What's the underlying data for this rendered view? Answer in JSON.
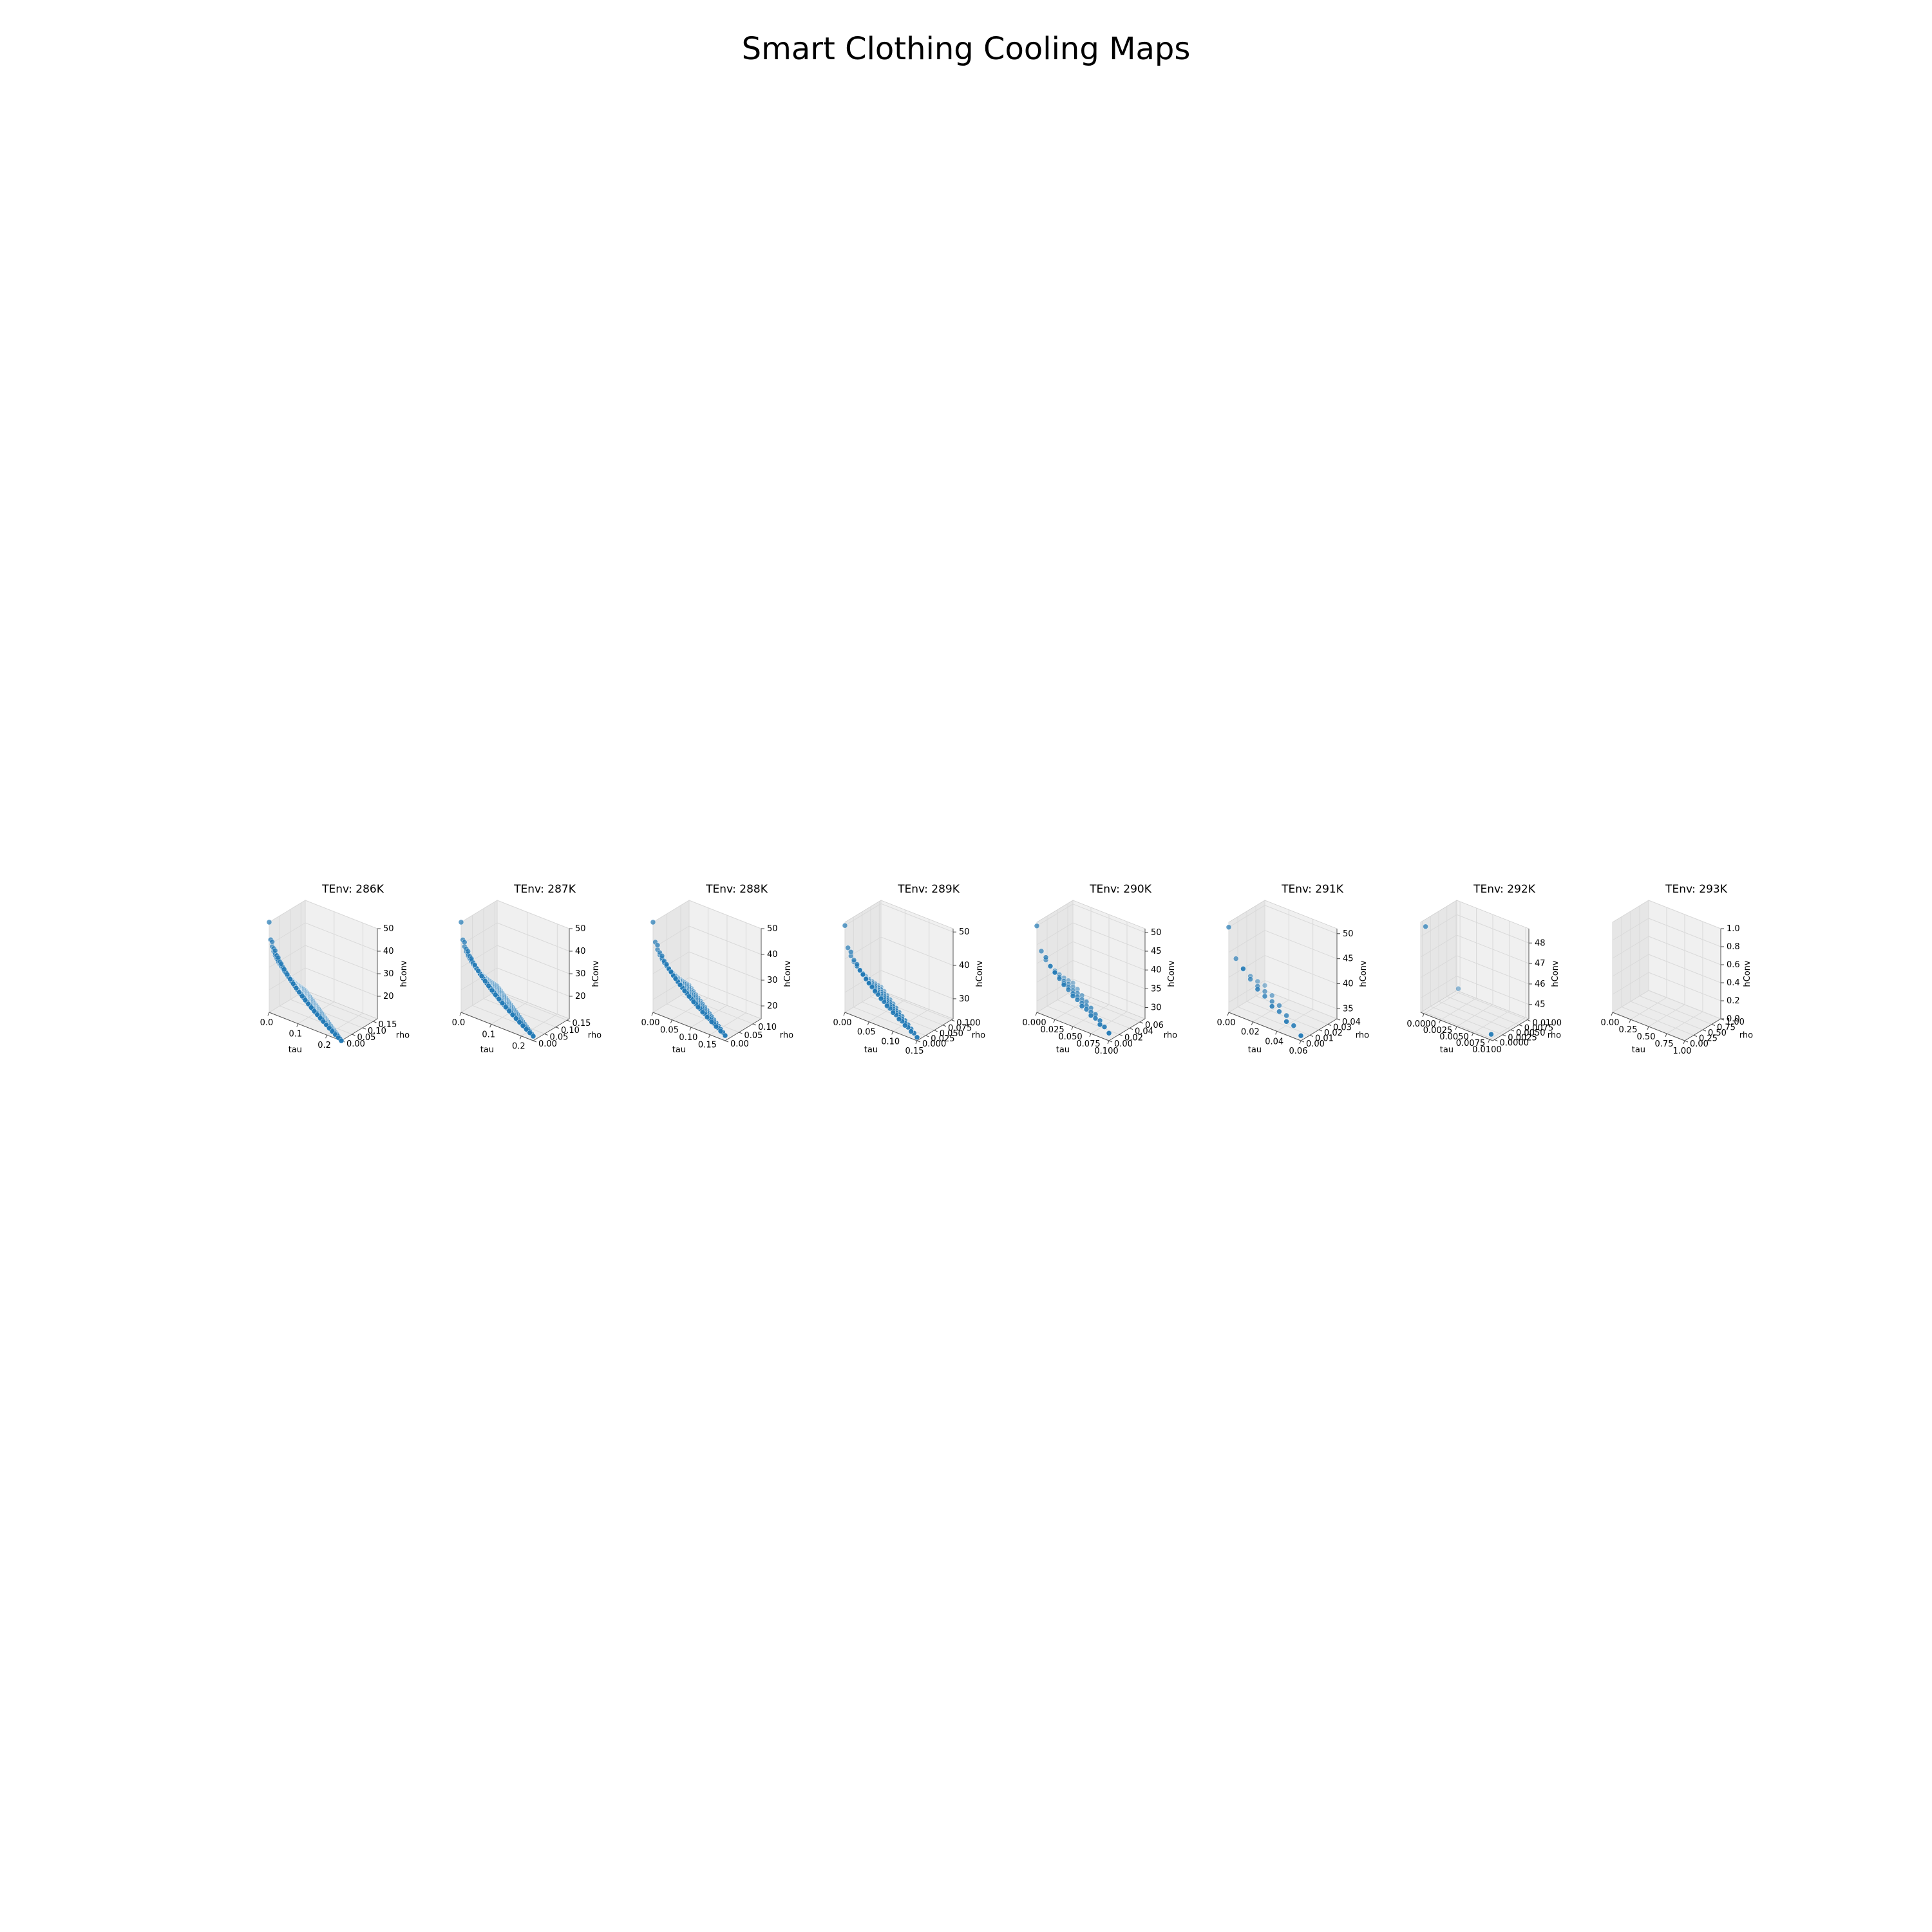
{
  "title": "Smart Clothing Cooling Maps",
  "colors": {
    "point": "#1f77b4",
    "pane_back": "#f0f0f0",
    "pane_side": "#e6e6e6",
    "pane_floor": "#ececec",
    "grid": "#d9d9d9"
  },
  "chart_data": [
    {
      "type": "scatter",
      "title": "TEnv: 286K",
      "xlabel": "tau",
      "ylabel": "rho",
      "zlabel": "hConv",
      "xlim": [
        0,
        0.25
      ],
      "ylim": [
        0,
        0.17
      ],
      "zlim": [
        10,
        50
      ],
      "xticks": [
        "0.0",
        "0.1",
        "0.2"
      ],
      "yticks": [
        "0.00",
        "0.05",
        "0.10",
        "0.15"
      ],
      "zticks": [
        "20",
        "30",
        "40",
        "50"
      ],
      "xtick_values": [
        0,
        0.1,
        0.2
      ],
      "ytick_values": [
        0,
        0.05,
        0.1,
        0.15
      ],
      "ztick_values": [
        20,
        30,
        40,
        50
      ],
      "grid": {
        "n": 24,
        "tau_max": 0.25,
        "rho_max": 0.17,
        "h_min": 10,
        "h_max": 50
      }
    },
    {
      "type": "scatter",
      "title": "TEnv: 287K",
      "xlabel": "tau",
      "ylabel": "rho",
      "zlabel": "hConv",
      "xlim": [
        0,
        0.24
      ],
      "ylim": [
        0,
        0.16
      ],
      "zlim": [
        10,
        50
      ],
      "xticks": [
        "0.0",
        "0.1",
        "0.2"
      ],
      "yticks": [
        "0.00",
        "0.05",
        "0.10",
        "0.15"
      ],
      "zticks": [
        "20",
        "30",
        "40",
        "50"
      ],
      "xtick_values": [
        0,
        0.1,
        0.2
      ],
      "ytick_values": [
        0,
        0.05,
        0.1,
        0.15
      ],
      "ztick_values": [
        20,
        30,
        40,
        50
      ],
      "grid": {
        "n": 21,
        "tau_max": 0.24,
        "rho_max": 0.16,
        "h_min": 12,
        "h_max": 50
      }
    },
    {
      "type": "scatter",
      "title": "TEnv: 288K",
      "xlabel": "tau",
      "ylabel": "rho",
      "zlabel": "hConv",
      "xlim": [
        0,
        0.19
      ],
      "ylim": [
        0,
        0.13
      ],
      "zlim": [
        15,
        50
      ],
      "xticks": [
        "0.00",
        "0.05",
        "0.10",
        "0.15"
      ],
      "yticks": [
        "0.00",
        "0.05",
        "0.10"
      ],
      "zticks": [
        "20",
        "30",
        "40",
        "50"
      ],
      "xtick_values": [
        0,
        0.05,
        0.1,
        0.15
      ],
      "ytick_values": [
        0,
        0.05,
        0.1
      ],
      "ztick_values": [
        20,
        30,
        40,
        50
      ],
      "grid": {
        "n": 16,
        "tau_max": 0.19,
        "rho_max": 0.13,
        "h_min": 17,
        "h_max": 50
      }
    },
    {
      "type": "scatter",
      "title": "TEnv: 289K",
      "xlabel": "tau",
      "ylabel": "rho",
      "zlabel": "hConv",
      "xlim": [
        0,
        0.15
      ],
      "ylim": [
        0,
        0.105
      ],
      "zlim": [
        24,
        51
      ],
      "xticks": [
        "0.00",
        "0.05",
        "0.10",
        "0.15"
      ],
      "yticks": [
        "0.000",
        "0.025",
        "0.050",
        "0.075",
        "0.100"
      ],
      "zticks": [
        "30",
        "40",
        "50"
      ],
      "xtick_values": [
        0,
        0.05,
        0.1,
        0.15
      ],
      "ytick_values": [
        0,
        0.025,
        0.05,
        0.075,
        0.1
      ],
      "ztick_values": [
        30,
        40,
        50
      ],
      "grid": {
        "n": 12,
        "tau_max": 0.15,
        "rho_max": 0.105,
        "h_min": 25,
        "h_max": 50
      }
    },
    {
      "type": "scatter",
      "title": "TEnv: 290K",
      "xlabel": "tau",
      "ylabel": "rho",
      "zlabel": "hConv",
      "xlim": [
        0,
        0.1
      ],
      "ylim": [
        0,
        0.07
      ],
      "zlim": [
        27,
        51
      ],
      "xticks": [
        "0.000",
        "0.025",
        "0.050",
        "0.075",
        "0.100"
      ],
      "yticks": [
        "0.00",
        "0.02",
        "0.04",
        "0.06"
      ],
      "zticks": [
        "30",
        "35",
        "40",
        "45",
        "50"
      ],
      "xtick_values": [
        0,
        0.025,
        0.05,
        0.075,
        0.1
      ],
      "ytick_values": [
        0,
        0.02,
        0.04,
        0.06
      ],
      "ztick_values": [
        30,
        35,
        40,
        45,
        50
      ],
      "grid": {
        "n": 8,
        "tau_max": 0.1,
        "rho_max": 0.07,
        "h_min": 29,
        "h_max": 50
      }
    },
    {
      "type": "scatter",
      "title": "TEnv: 291K",
      "xlabel": "tau",
      "ylabel": "rho",
      "zlabel": "hConv",
      "xlim": [
        0,
        0.06
      ],
      "ylim": [
        0,
        0.04
      ],
      "zlim": [
        33,
        51
      ],
      "xticks": [
        "0.00",
        "0.02",
        "0.04",
        "0.06"
      ],
      "yticks": [
        "0.00",
        "0.01",
        "0.02",
        "0.03",
        "0.04"
      ],
      "zticks": [
        "35",
        "40",
        "45",
        "50"
      ],
      "xtick_values": [
        0,
        0.02,
        0.04,
        0.06
      ],
      "ytick_values": [
        0,
        0.01,
        0.02,
        0.03,
        0.04
      ],
      "ztick_values": [
        35,
        40,
        45,
        50
      ],
      "grid": {
        "n": 5,
        "tau_max": 0.06,
        "rho_max": 0.04,
        "h_min": 34,
        "h_max": 50
      }
    },
    {
      "type": "scatter",
      "title": "TEnv: 292K",
      "xlabel": "tau",
      "ylabel": "rho",
      "zlabel": "hConv",
      "xlim": [
        -0.0005,
        0.0105
      ],
      "ylim": [
        -0.0005,
        0.0105
      ],
      "zlim": [
        44.3,
        48.7
      ],
      "xticks": [
        "0.0000",
        "0.0025",
        "0.0050",
        "0.0075",
        "0.0100"
      ],
      "yticks": [
        "0.0000",
        "0.0025",
        "0.0050",
        "0.0075",
        "0.0100"
      ],
      "zticks": [
        "45",
        "46",
        "47",
        "48"
      ],
      "xtick_values": [
        0,
        0.0025,
        0.005,
        0.0075,
        0.01
      ],
      "ytick_values": [
        0,
        0.0025,
        0.005,
        0.0075,
        0.01
      ],
      "ztick_values": [
        45,
        46,
        47,
        48
      ],
      "points": [
        [
          0,
          0,
          48.5
        ],
        [
          0.01,
          0,
          44.5
        ],
        [
          0,
          0.01,
          44.5
        ]
      ]
    },
    {
      "type": "scatter",
      "title": "TEnv: 293K",
      "xlabel": "tau",
      "ylabel": "rho",
      "zlabel": "hConv",
      "xlim": [
        0,
        1
      ],
      "ylim": [
        0,
        1
      ],
      "zlim": [
        0,
        1
      ],
      "xticks": [
        "0.00",
        "0.25",
        "0.50",
        "0.75",
        "1.00"
      ],
      "yticks": [
        "0.00",
        "0.25",
        "0.50",
        "0.75",
        "1.00"
      ],
      "zticks": [
        "0.0",
        "0.2",
        "0.4",
        "0.6",
        "0.8",
        "1.0"
      ],
      "xtick_values": [
        0,
        0.25,
        0.5,
        0.75,
        1
      ],
      "ytick_values": [
        0,
        0.25,
        0.5,
        0.75,
        1
      ],
      "ztick_values": [
        0,
        0.2,
        0.4,
        0.6,
        0.8,
        1
      ],
      "points": []
    }
  ]
}
